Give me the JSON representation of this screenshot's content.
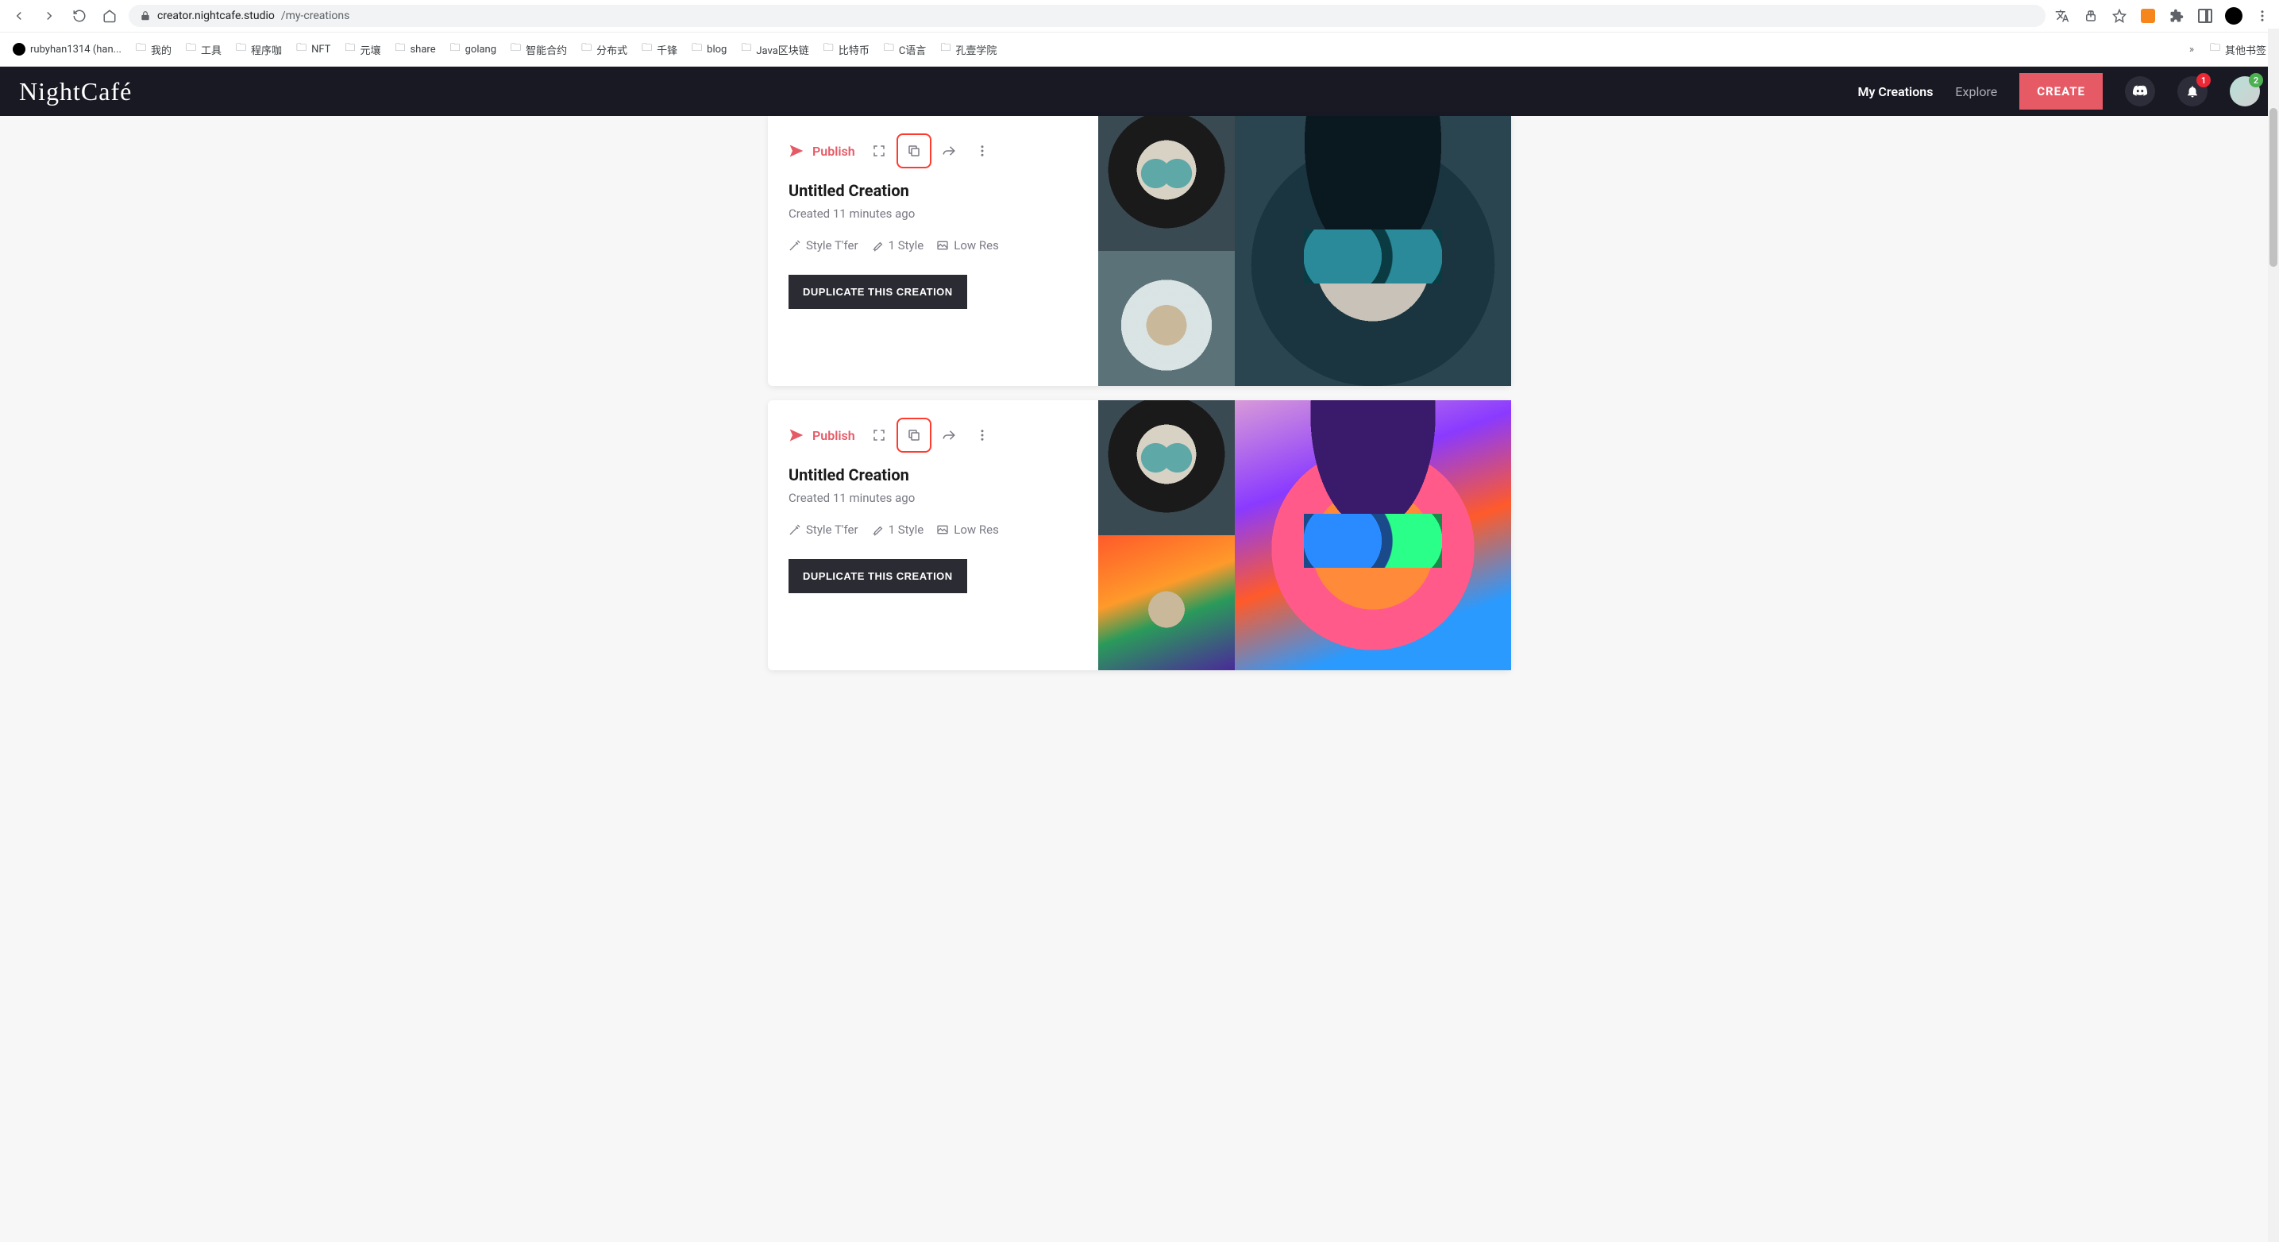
{
  "browser": {
    "url_host": "creator.nightcafe.studio",
    "url_path": "/my-creations",
    "bookmarks": [
      {
        "label": "rubyhan1314 (han...",
        "type": "github"
      },
      {
        "label": "我的"
      },
      {
        "label": "工具"
      },
      {
        "label": "程序咖"
      },
      {
        "label": "NFT"
      },
      {
        "label": "元壤"
      },
      {
        "label": "share"
      },
      {
        "label": "golang"
      },
      {
        "label": "智能合约"
      },
      {
        "label": "分布式"
      },
      {
        "label": "千锋"
      },
      {
        "label": "blog"
      },
      {
        "label": "Java区块链"
      },
      {
        "label": "比特币"
      },
      {
        "label": "C语言"
      },
      {
        "label": "孔壹学院"
      }
    ],
    "overflow_bookmark": "其他书签"
  },
  "header": {
    "logo": "NightCafé",
    "nav": {
      "my_creations": "My Creations",
      "explore": "Explore",
      "create": "CREATE"
    },
    "notif_badge": "1",
    "avatar_badge": "2"
  },
  "creations": [
    {
      "publish_label": "Publish",
      "title": "Untitled Creation",
      "created": "Created 11 minutes ago",
      "tags": {
        "algo": "Style T'fer",
        "styles": "1 Style",
        "res": "Low Res"
      },
      "duplicate_label": "DUPLICATE THIS CREATION"
    },
    {
      "publish_label": "Publish",
      "title": "Untitled Creation",
      "created": "Created 11 minutes ago",
      "tags": {
        "algo": "Style T'fer",
        "styles": "1 Style",
        "res": "Low Res"
      },
      "duplicate_label": "DUPLICATE THIS CREATION"
    }
  ]
}
